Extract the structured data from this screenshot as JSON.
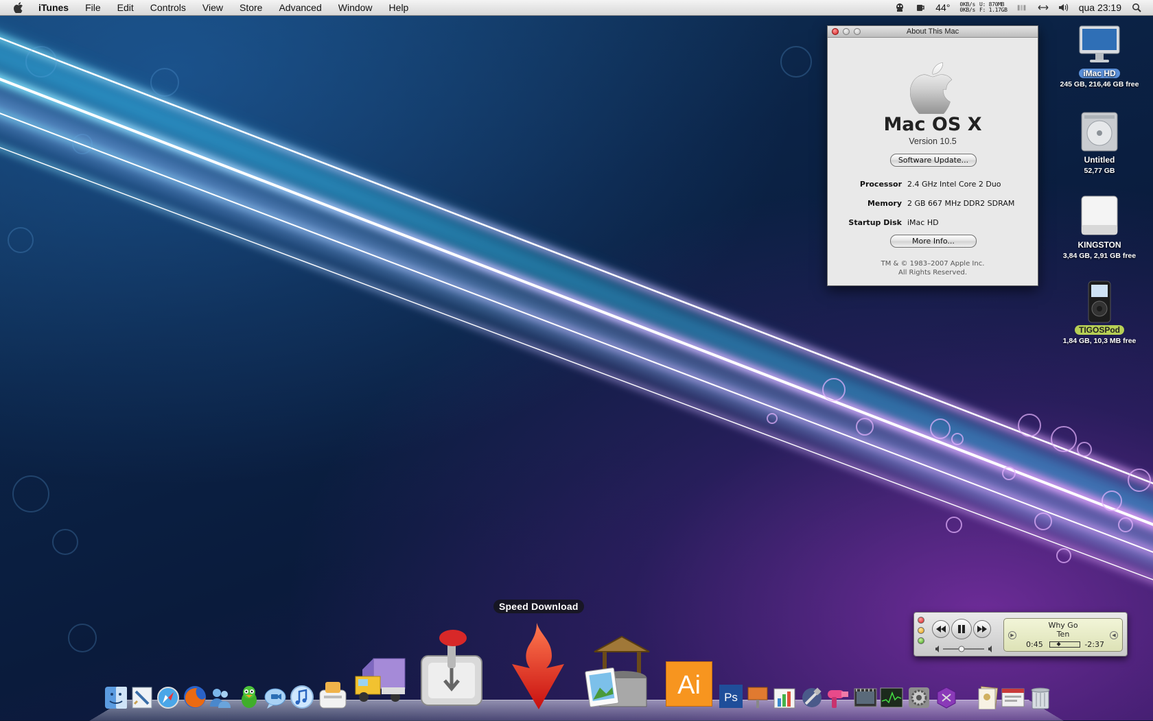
{
  "menubar": {
    "app_name": "iTunes",
    "menus": [
      "File",
      "Edit",
      "Controls",
      "View",
      "Store",
      "Advanced",
      "Window",
      "Help"
    ],
    "temperature": "44°",
    "net_down": "0KB/s",
    "net_up": "0KB/s",
    "mem_used_label": "U:",
    "mem_used": "870MB",
    "mem_free_label": "F:",
    "mem_free": "1.17GB",
    "clock": "qua 23:19",
    "icons": [
      "apple-icon",
      "adium-icon",
      "coffee-icon",
      "network-sync-icon",
      "volume-icon",
      "spotlight-icon"
    ]
  },
  "about_window": {
    "title": "About This Mac",
    "os_name": "Mac OS X",
    "version": "Version 10.5",
    "software_update_label": "Software Update...",
    "processor_label": "Processor",
    "processor_value": "2.4 GHz Intel Core 2 Duo",
    "memory_label": "Memory",
    "memory_value": "2 GB 667 MHz DDR2 SDRAM",
    "startup_disk_label": "Startup Disk",
    "startup_disk_value": "iMac HD",
    "more_info_label": "More Info...",
    "copyright_line1": "TM & © 1983–2007 Apple Inc.",
    "copyright_line2": "All Rights Reserved."
  },
  "desktop_icons": [
    {
      "name": "iMac HD",
      "sub": "245 GB, 216,46 GB free",
      "icon": "imac-icon"
    },
    {
      "name": "Untitled",
      "sub": "52,77 GB",
      "icon": "hard-drive-icon"
    },
    {
      "name": "KINGSTON",
      "sub": "3,84 GB, 2,91 GB free",
      "icon": "usb-drive-icon"
    },
    {
      "name": "TIGOSPod",
      "sub": "1,84 GB, 10,3 MB free",
      "icon": "ipod-icon"
    }
  ],
  "mini_player": {
    "track_title": "Why Go",
    "track_album": "Ten",
    "elapsed": "0:45",
    "remaining": "-2:37",
    "progress_fraction": 0.22,
    "volume_fraction": 0.45
  },
  "dock": {
    "hover_label": "Speed Download",
    "items": [
      "finder-icon",
      "mail-icon",
      "safari-icon",
      "firefox-icon",
      "ichat-buddies-icon",
      "adium-icon",
      "ichat-icon",
      "itunes-icon",
      "toaster-icon",
      "transmit-icon",
      "transmission-icon",
      "speed-download-icon",
      "image-well-icon",
      "illustrator-icon",
      "photoshop-icon",
      "keynote-icon",
      "numbers-icon",
      "xcode-icon",
      "hair-dryer-icon",
      "quicktime-icon",
      "activity-monitor-icon",
      "system-preferences-icon",
      "textmate-icon",
      "documents-stack-icon",
      "downloads-stack-icon",
      "trash-icon"
    ],
    "illustrator_text": "Ai",
    "photoshop_text": "Ps"
  }
}
